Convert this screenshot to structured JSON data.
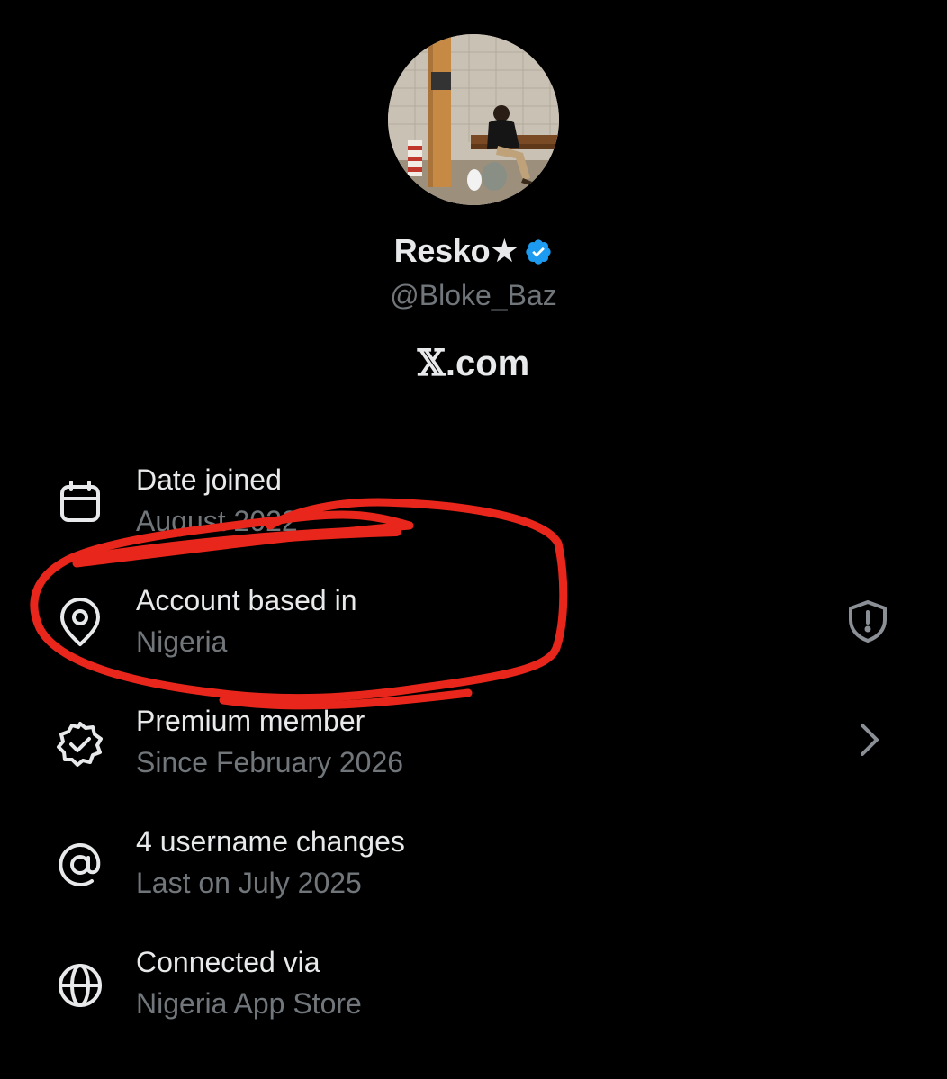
{
  "profile": {
    "display_name": "Resko★",
    "handle": "@Bloke_Baz",
    "verified_badge_icon": "verified-badge-icon",
    "avatar_image": "profile-photo"
  },
  "brand": {
    "mark": "𝕏",
    "suffix": ".com"
  },
  "rows": [
    {
      "icon": "calendar-icon",
      "label": "Date joined",
      "value": "August 2022"
    },
    {
      "icon": "location-pin-icon",
      "label": "Account based in",
      "value": "Nigeria",
      "trailing_icon": "shield-alert-icon"
    },
    {
      "icon": "verified-seal-icon",
      "label": "Premium member",
      "value": "Since February 2026",
      "trailing_icon": "chevron-right-icon"
    },
    {
      "icon": "at-sign-icon",
      "label": "4 username changes",
      "value": "Last on July 2025"
    },
    {
      "icon": "globe-icon",
      "label": "Connected via",
      "value": "Nigeria App Store"
    }
  ],
  "colors": {
    "background": "#000000",
    "primary_text": "#e7e9ea",
    "secondary_text": "#71767b",
    "verified_blue": "#1d9bf0",
    "annotation_red": "#e8261b"
  }
}
